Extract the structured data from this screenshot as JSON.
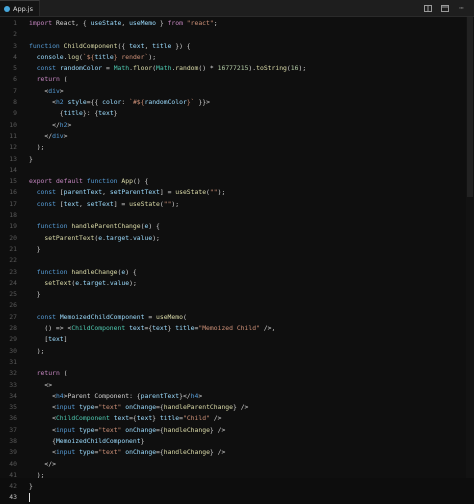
{
  "tabs": [
    {
      "label": "App.js",
      "close_icon": "close-icon"
    }
  ],
  "actions": {
    "split": "split-editor-icon",
    "more": "more-icon",
    "layout": "layout-icon"
  },
  "code_lines": [
    {
      "n": "1"
    },
    {
      "n": "2"
    },
    {
      "n": "3"
    },
    {
      "n": "4"
    },
    {
      "n": "5"
    },
    {
      "n": "6"
    },
    {
      "n": "7"
    },
    {
      "n": "8"
    },
    {
      "n": "9"
    },
    {
      "n": "10"
    },
    {
      "n": "11"
    },
    {
      "n": "12"
    },
    {
      "n": "13"
    },
    {
      "n": "14"
    },
    {
      "n": "15"
    },
    {
      "n": "16"
    },
    {
      "n": "17"
    },
    {
      "n": "18"
    },
    {
      "n": "19"
    },
    {
      "n": "20"
    },
    {
      "n": "21"
    },
    {
      "n": "22"
    },
    {
      "n": "23"
    },
    {
      "n": "24"
    },
    {
      "n": "25"
    },
    {
      "n": "26"
    },
    {
      "n": "27"
    },
    {
      "n": "28"
    },
    {
      "n": "29"
    },
    {
      "n": "30"
    },
    {
      "n": "31"
    },
    {
      "n": "32"
    },
    {
      "n": "33"
    },
    {
      "n": "34"
    },
    {
      "n": "35"
    },
    {
      "n": "36"
    },
    {
      "n": "37"
    },
    {
      "n": "38"
    },
    {
      "n": "39"
    },
    {
      "n": "40"
    },
    {
      "n": "41"
    },
    {
      "n": "42"
    },
    {
      "n": "43"
    }
  ],
  "text": {
    "l1": [
      "import",
      " React, { ",
      "useState",
      ", ",
      "useMemo",
      " } ",
      "from",
      " ",
      "\"react\"",
      ";"
    ],
    "l3": [
      "function",
      " ",
      "ChildComponent",
      "({ ",
      "text",
      ", ",
      "title",
      " }) {"
    ],
    "l4": [
      "console",
      ".",
      "log",
      "(",
      "`${",
      "title",
      "} render`",
      ");"
    ],
    "l5": [
      "const",
      " ",
      "randomColor",
      " = ",
      "Math",
      ".",
      "floor",
      "(",
      "Math",
      ".",
      "random",
      "() * ",
      "16777215",
      ").",
      "toString",
      "(",
      "16",
      ");"
    ],
    "l6": [
      "return",
      " ("
    ],
    "l7": [
      "<",
      "div",
      ">"
    ],
    "l8": [
      "<",
      "h2",
      " ",
      "style",
      "={{ ",
      "color",
      ": ",
      "`#${",
      "randomColor",
      "}`",
      " }}>"
    ],
    "l9": [
      "{",
      "title",
      "}: {",
      "text",
      "}"
    ],
    "l10": [
      "</",
      "h2",
      ">"
    ],
    "l11": [
      "</",
      "div",
      ">"
    ],
    "l12": [
      ");"
    ],
    "l13": [
      "}"
    ],
    "l15": [
      "export",
      " ",
      "default",
      " ",
      "function",
      " ",
      "App",
      "() {"
    ],
    "l16": [
      "const",
      " [",
      "parentText",
      ", ",
      "setParentText",
      "] = ",
      "useState",
      "(",
      "\"\"",
      ");"
    ],
    "l17": [
      "const",
      " [",
      "text",
      ", ",
      "setText",
      "] = ",
      "useState",
      "(",
      "\"\"",
      ");"
    ],
    "l19": [
      "function",
      " ",
      "handleParentChange",
      "(",
      "e",
      ") {"
    ],
    "l20": [
      "setParentText",
      "(",
      "e",
      ".",
      "target",
      ".",
      "value",
      ");"
    ],
    "l21": [
      "}"
    ],
    "l23": [
      "function",
      " ",
      "handleChange",
      "(",
      "e",
      ") {"
    ],
    "l24": [
      "setText",
      "(",
      "e",
      ".",
      "target",
      ".",
      "value",
      ");"
    ],
    "l25": [
      "}"
    ],
    "l27": [
      "const",
      " ",
      "MemoizedChildComponent",
      " = ",
      "useMemo",
      "("
    ],
    "l28": [
      "() => <",
      "ChildComponent",
      " ",
      "text",
      "={",
      "text",
      "} ",
      "title",
      "=",
      "\"Memoized Child\"",
      " />,"
    ],
    "l29": [
      "[",
      "text",
      "]"
    ],
    "l30": [
      ");"
    ],
    "l32": [
      "return",
      " ("
    ],
    "l33": [
      "<>"
    ],
    "l34": [
      "<",
      "h4",
      ">Parent Component: {",
      "parentText",
      "}</",
      "h4",
      ">"
    ],
    "l35": [
      "<",
      "input",
      " ",
      "type",
      "=",
      "\"text\"",
      " ",
      "onChange",
      "={",
      "handleParentChange",
      "} />"
    ],
    "l36": [
      "<",
      "ChildComponent",
      " ",
      "text",
      "={",
      "text",
      "} ",
      "title",
      "=",
      "\"Child\"",
      " />"
    ],
    "l37": [
      "<",
      "input",
      " ",
      "type",
      "=",
      "\"text\"",
      " ",
      "onChange",
      "={",
      "handleChange",
      "} />"
    ],
    "l38": [
      "{",
      "MemoizedChildComponent",
      "}"
    ],
    "l39": [
      "<",
      "input",
      " ",
      "type",
      "=",
      "\"text\"",
      " ",
      "onChange",
      "={",
      "handleChange",
      "} />"
    ],
    "l40": [
      "</>"
    ],
    "l41": [
      ");"
    ],
    "l42": [
      "}"
    ]
  }
}
